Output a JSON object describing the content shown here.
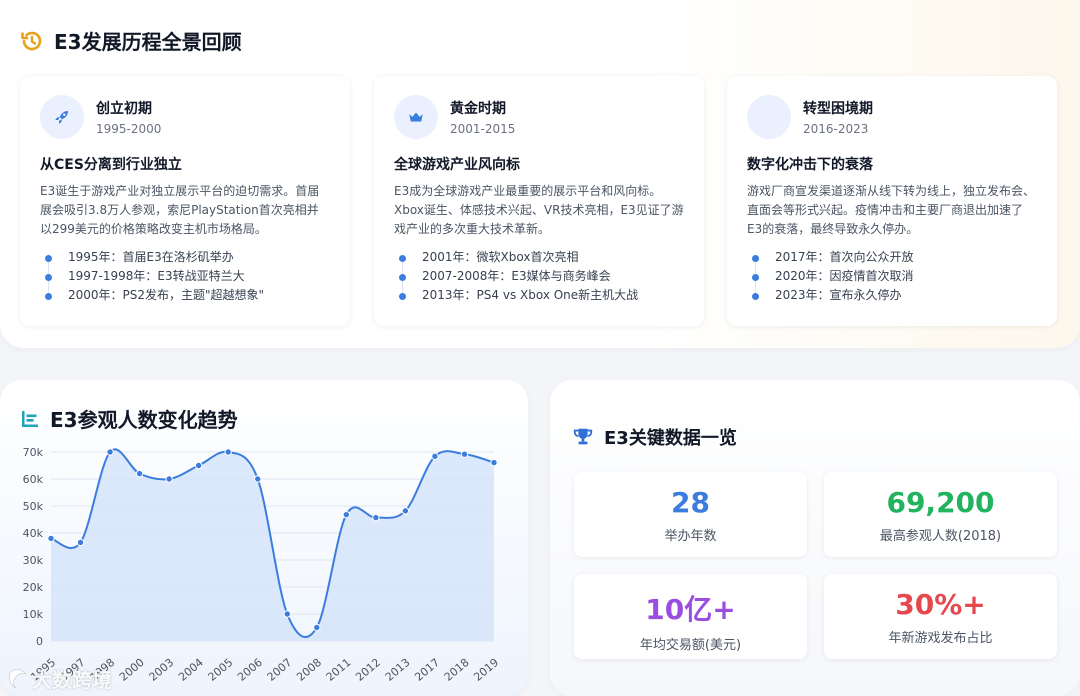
{
  "header": {
    "title": "E3发展历程全景回顾"
  },
  "phases": [
    {
      "phase": "创立初期",
      "years": "1995-2000",
      "subtitle": "从CES分离到行业独立",
      "description": "E3诞生于游戏产业对独立展示平台的迫切需求。首届展会吸引3.8万人参观，索尼PlayStation首次亮相并以299美元的价格策略改变主机市场格局。",
      "events": [
        "1995年：首届E3在洛杉矶举办",
        "1997-1998年：E3转战亚特兰大",
        "2000年：PS2发布，主题\"超越想象\""
      ],
      "icon": "rocket-icon"
    },
    {
      "phase": "黄金时期",
      "years": "2001-2015",
      "subtitle": "全球游戏产业风向标",
      "description": "E3成为全球游戏产业最重要的展示平台和风向标。Xbox诞生、体感技术兴起、VR技术亮相，E3见证了游戏产业的多次重大技术革新。",
      "events": [
        "2001年：微软Xbox首次亮相",
        "2007-2008年：E3媒体与商务峰会",
        "2013年：PS4 vs Xbox One新主机大战"
      ],
      "icon": "crown-icon"
    },
    {
      "phase": "转型困境期",
      "years": "2016-2023",
      "subtitle": "数字化冲击下的衰落",
      "description": "游戏厂商宣发渠道逐渐从线下转为线上，独立发布会、直面会等形式兴起。疫情冲击和主要厂商退出加速了E3的衰落，最终导致永久停办。",
      "events": [
        "2017年：首次向公众开放",
        "2020年：因疫情首次取消",
        "2023年：宣布永久停办"
      ],
      "icon": "blank-icon"
    }
  ],
  "chart_section": {
    "title": "E3参观人数变化趋势"
  },
  "chart_data": {
    "type": "area",
    "title": "E3参观人数变化趋势",
    "categories": [
      "1995",
      "1997",
      "1998",
      "2000",
      "2003",
      "2004",
      "2005",
      "2006",
      "2007",
      "2008",
      "2011",
      "2012",
      "2013",
      "2017",
      "2018",
      "2019"
    ],
    "values": [
      38000,
      36500,
      70000,
      62000,
      60000,
      65000,
      70000,
      60000,
      10000,
      5000,
      46800,
      45700,
      48200,
      68400,
      69200,
      66100
    ],
    "yticks": [
      "0",
      "10k",
      "20k",
      "30k",
      "40k",
      "50k",
      "60k",
      "70k"
    ],
    "ylim": [
      0,
      70000
    ],
    "grid": true,
    "line_color": "#3b7ddd",
    "fill_color": "#d6e4fa"
  },
  "stats_section": {
    "title": "E3关键数据一览"
  },
  "stats": [
    {
      "value": "28",
      "label": "举办年数",
      "color": "#3b7ddd"
    },
    {
      "value": "69,200",
      "label": "最高参观人数(2018)",
      "color": "#22b35e"
    },
    {
      "value": "10亿+",
      "label": "年均交易额(美元)",
      "color": "#9b4de0"
    },
    {
      "value": "30%+",
      "label": "年新游戏发布占比",
      "color": "#e5484d"
    }
  ],
  "watermark": {
    "text": "大数跨境"
  },
  "colors": {
    "accent": "#3b7ddd",
    "header_icon": "#e8a21a",
    "trophy": "#2f6fd6"
  }
}
